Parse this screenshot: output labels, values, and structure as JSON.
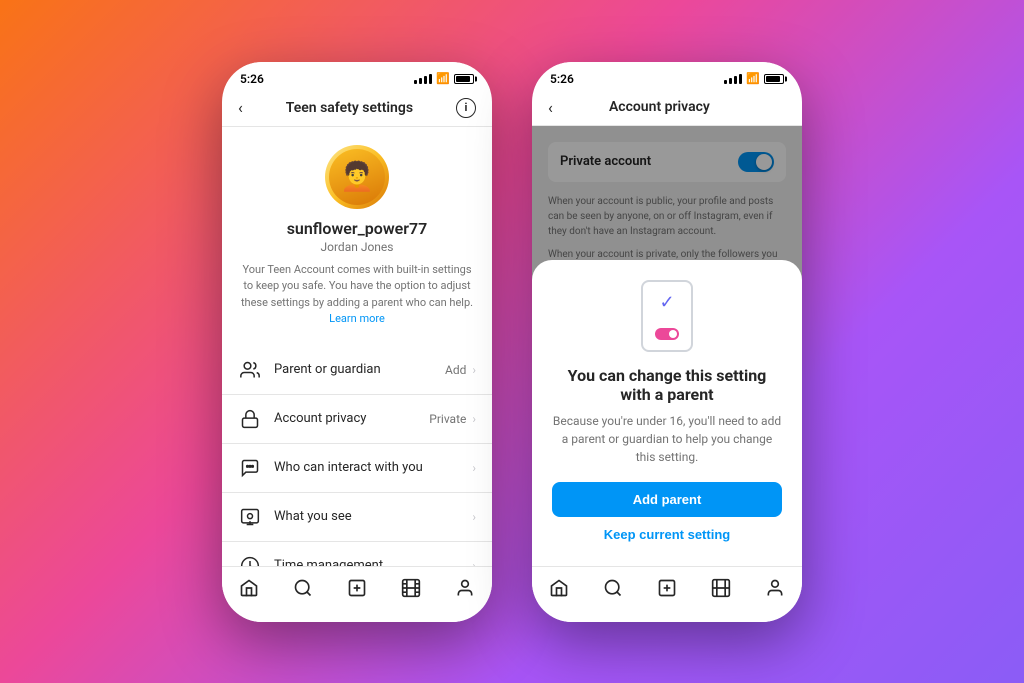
{
  "background": "gradient pink-orange-purple",
  "phone1": {
    "status_time": "5:26",
    "header_title": "Teen safety settings",
    "back_label": "‹",
    "info_label": "i",
    "username": "sunflower_power77",
    "real_name": "Jordan Jones",
    "description": "Your Teen Account comes with built-in settings to keep you safe. You have the option to adjust these settings by adding a parent who can help.",
    "learn_more": "Learn more",
    "settings": [
      {
        "icon": "person",
        "label": "Parent or guardian",
        "value": "Add",
        "id": "parent"
      },
      {
        "icon": "lock",
        "label": "Account privacy",
        "value": "Private",
        "id": "privacy"
      },
      {
        "icon": "message",
        "label": "Who can interact with you",
        "value": "",
        "id": "interact"
      },
      {
        "icon": "eye",
        "label": "What you see",
        "value": "",
        "id": "see"
      },
      {
        "icon": "clock",
        "label": "Time management",
        "value": "",
        "id": "time"
      }
    ],
    "nav": [
      "home",
      "search",
      "add",
      "reels",
      "profile"
    ]
  },
  "phone2": {
    "status_time": "5:26",
    "header_title": "Account privacy",
    "back_label": "‹",
    "private_account_label": "Private account",
    "description1": "When your account is public, your profile and posts can be seen by anyone, on or off Instagram, even if they don't have an Instagram account.",
    "description2": "When your account is private, only the followers you approve can see what you share, including your photos or videos on hashtag and location pages, and your followers and following lists.",
    "sheet": {
      "title": "You can change this setting with a parent",
      "description": "Because you're under 16, you'll need to add a parent or guardian to help you change this setting.",
      "add_parent_label": "Add parent",
      "keep_current_label": "Keep current setting"
    },
    "nav": [
      "home",
      "search",
      "add",
      "reels",
      "profile"
    ]
  }
}
